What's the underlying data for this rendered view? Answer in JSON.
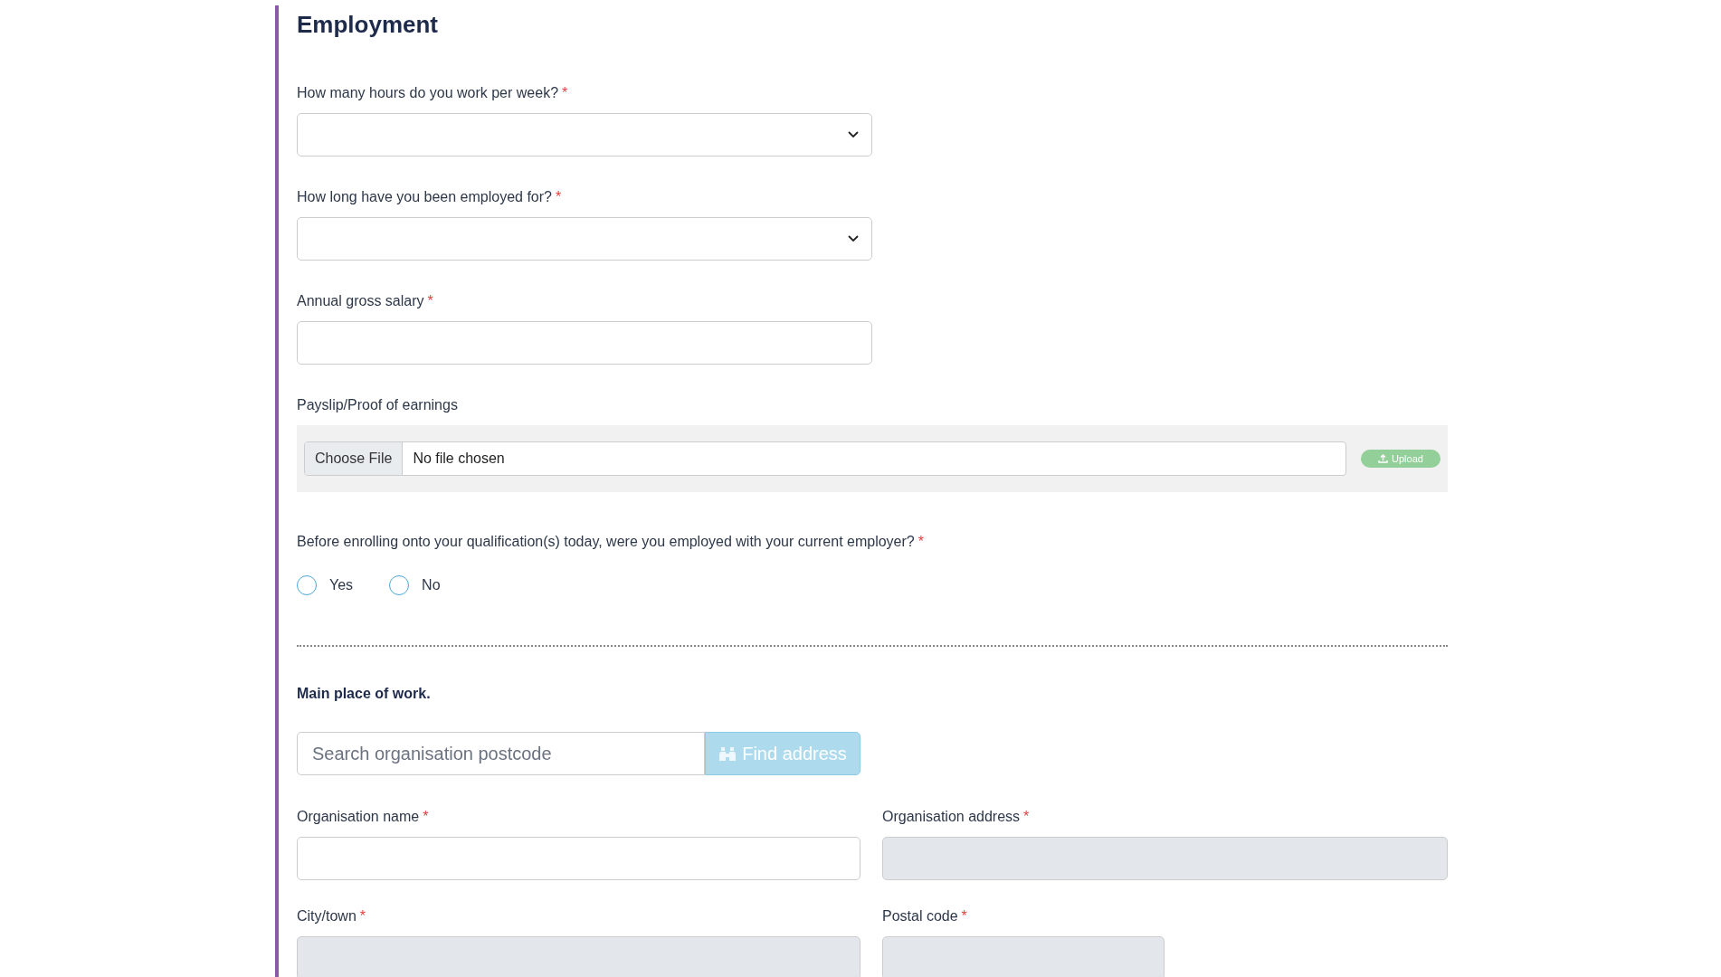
{
  "heading": "Employment",
  "fields": [
    {
      "kind": "select",
      "label": "How many hours do you work per week?",
      "required_mark": "*"
    },
    {
      "kind": "select",
      "label": "How long have you been employed for?",
      "required_mark": "*"
    },
    {
      "kind": "text",
      "label": "Annual gross salary",
      "required_mark": "*"
    },
    {
      "kind": "file",
      "label": "Payslip/Proof of earnings",
      "button": "Choose File",
      "status": "No file chosen",
      "upload": "Upload"
    },
    {
      "kind": "radio",
      "label": "Before enrolling onto your qualification(s) today, were you employed with your current employer?",
      "required_mark": "*",
      "options": [
        {
          "label": "Yes",
          "selected": false
        },
        {
          "label": "No",
          "selected": false
        }
      ]
    }
  ],
  "address": {
    "title": "Main place of work.",
    "search": {
      "placeholder": "Search organisation postcode"
    },
    "find_button": "Find address",
    "fields": [
      {
        "kind": "wide",
        "label": "Organisation name",
        "required_mark": "*",
        "disabled": false
      },
      {
        "kind": "wide",
        "label": "Organisation address",
        "required_mark": "*",
        "disabled": true
      },
      {
        "kind": "wide",
        "label": "City/town",
        "required_mark": "*",
        "disabled": true
      },
      {
        "kind": "short",
        "label": "Postal code",
        "required_mark": "*",
        "disabled": true
      }
    ]
  }
}
